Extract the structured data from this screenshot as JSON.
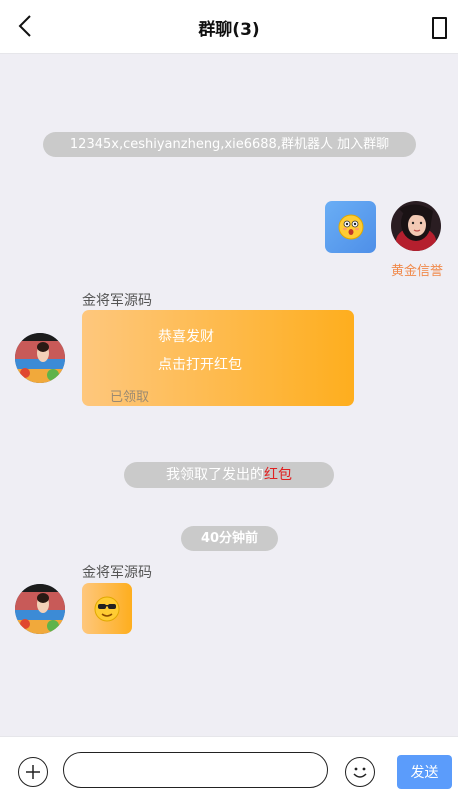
{
  "header": {
    "title": "群聊(3)",
    "back_icon": "chevron-left-icon",
    "menu_icon": "rectangle-menu-icon"
  },
  "messages": {
    "join_notice": "12345x,ceshiyanzheng,xie6688,群机器人 加入群聊",
    "self_name": "黄金信誉",
    "sender_1_name": "金将军源码",
    "red_packet": {
      "greeting": "恭喜发财",
      "action": "点击打开红包",
      "status": "已领取"
    },
    "claim_notice_prefix": "我领取了发出的",
    "claim_notice_link": "红包",
    "time_label": "40分钟前",
    "sender_2_name": "金将军源码"
  },
  "input": {
    "value": "",
    "placeholder": "",
    "send_label": "发送",
    "plus_icon": "plus-circle-icon",
    "emoji_icon": "smile-icon"
  },
  "colors": {
    "accent_blue": "#5b9cfb",
    "self_name_color": "#f08a4b",
    "red_packet_start": "#fec77d",
    "red_packet_end": "#feae1e",
    "link_red": "#e02020"
  }
}
